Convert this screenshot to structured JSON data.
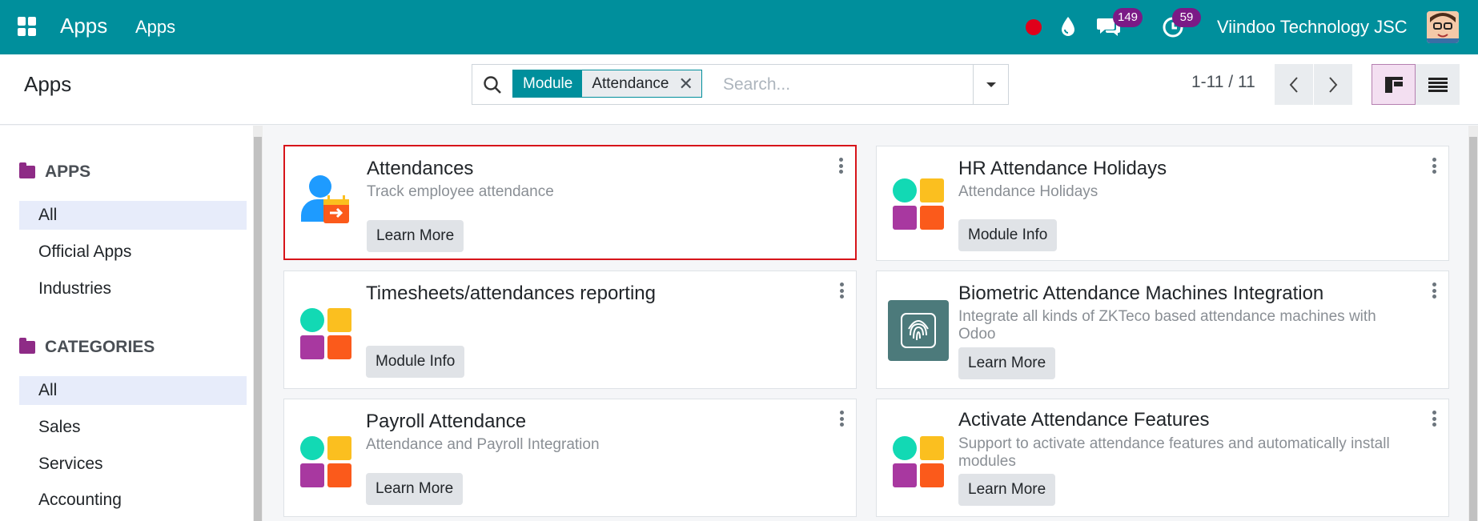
{
  "topbar": {
    "brand": "Apps",
    "menu": [
      "Apps"
    ],
    "chat_count": "149",
    "activity_count": "59",
    "company": "Viindoo Technology JSC"
  },
  "control_panel": {
    "title": "Apps",
    "facet": {
      "key": "Module",
      "value": "Attendance"
    },
    "search_placeholder": "Search...",
    "pager": "1-11 / 11"
  },
  "sidebar": {
    "apps_heading": "APPS",
    "apps_items": [
      "All",
      "Official Apps",
      "Industries"
    ],
    "categories_heading": "CATEGORIES",
    "categories_items": [
      "All",
      "Sales",
      "Services",
      "Accounting"
    ]
  },
  "cards": [
    {
      "title": "Attendances",
      "summary": "Track employee attendance",
      "button": "Learn More",
      "icon": "attendance-icon"
    },
    {
      "title": "HR Attendance Holidays",
      "summary": "Attendance Holidays",
      "button": "Module Info",
      "icon": "module-placeholder-icon"
    },
    {
      "title": "Timesheets/attendances reporting",
      "summary": "",
      "button": "Module Info",
      "icon": "module-placeholder-icon"
    },
    {
      "title": "Biometric Attendance Machines Integration",
      "summary": "Integrate all kinds of ZKTeco based attendance machines with Odoo",
      "button": "Learn More",
      "icon": "fingerprint-icon"
    },
    {
      "title": "Payroll Attendance",
      "summary": "Attendance and Payroll Integration",
      "button": "Learn More",
      "icon": "module-placeholder-icon"
    },
    {
      "title": "Activate Attendance Features",
      "summary": "Support to activate attendance features and automatically install modules",
      "button": "Learn More",
      "icon": "module-placeholder-icon"
    }
  ],
  "colors": {
    "primary": "#008f9c",
    "badge": "#7b1a86",
    "highlight_border": "#d7141a"
  }
}
